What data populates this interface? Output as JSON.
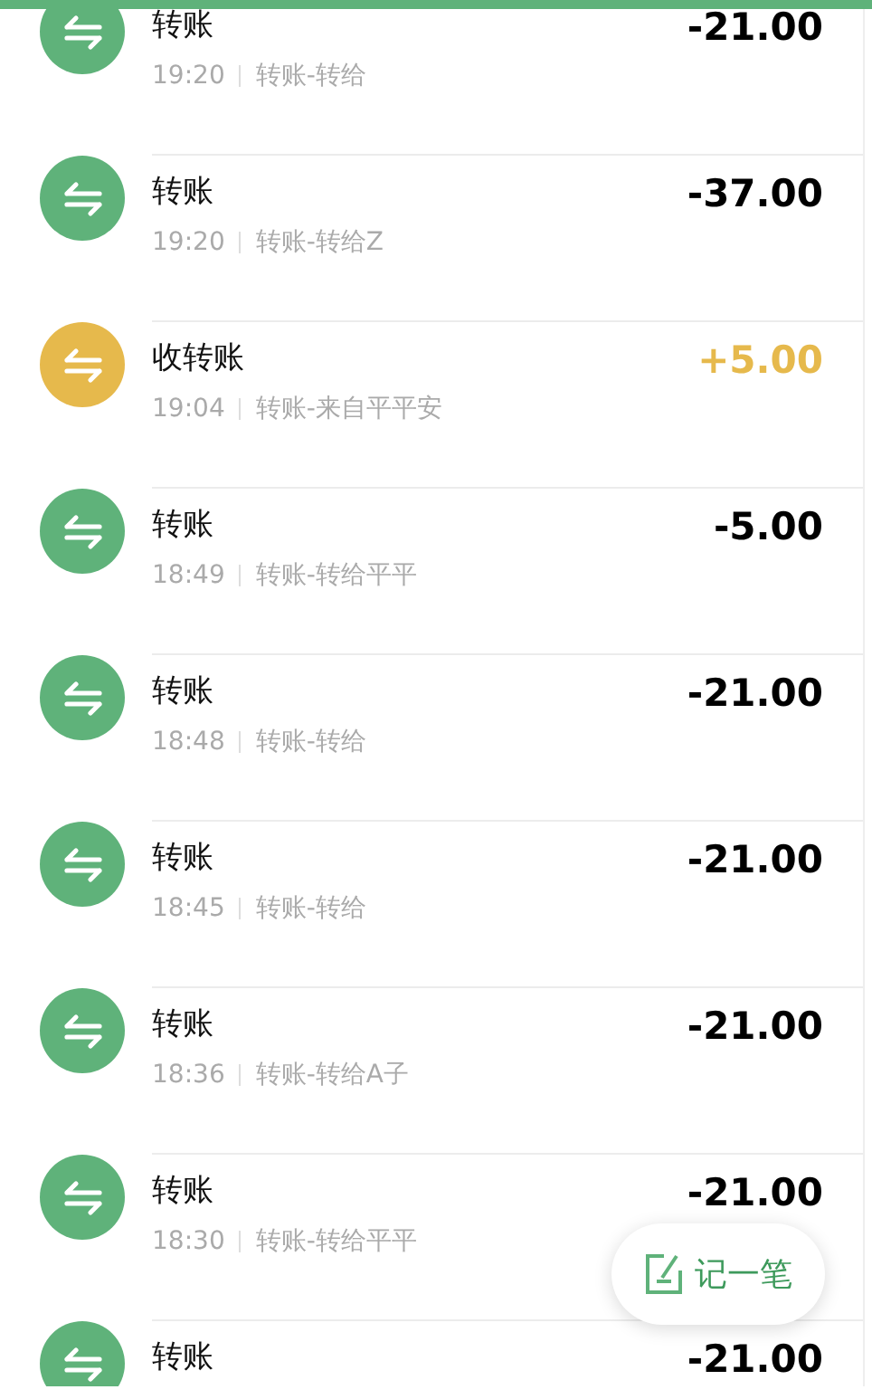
{
  "transactions": [
    {
      "kind": "expense",
      "title": "转账",
      "time": "19:20",
      "detail": "转账-转给",
      "amount": "-21.00"
    },
    {
      "kind": "expense",
      "title": "转账",
      "time": "19:20",
      "detail": "转账-转给Z",
      "amount": "-37.00"
    },
    {
      "kind": "income",
      "title": "收转账",
      "time": "19:04",
      "detail": "转账-来自平平安",
      "amount": "+5.00"
    },
    {
      "kind": "expense",
      "title": "转账",
      "time": "18:49",
      "detail": "转账-转给平平",
      "amount": "-5.00"
    },
    {
      "kind": "expense",
      "title": "转账",
      "time": "18:48",
      "detail": "转账-转给",
      "amount": "-21.00"
    },
    {
      "kind": "expense",
      "title": "转账",
      "time": "18:45",
      "detail": "转账-转给",
      "amount": "-21.00"
    },
    {
      "kind": "expense",
      "title": "转账",
      "time": "18:36",
      "detail": "转账-转给A子",
      "amount": "-21.00"
    },
    {
      "kind": "expense",
      "title": "转账",
      "time": "18:30",
      "detail": "转账-转给平平",
      "amount": "-21.00"
    },
    {
      "kind": "expense",
      "title": "转账",
      "amount": "-21.00"
    }
  ],
  "fab": {
    "label": "记一笔"
  }
}
